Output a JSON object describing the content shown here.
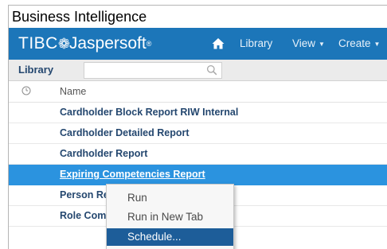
{
  "app": {
    "title": "Business Intelligence"
  },
  "brand": {
    "part1": "TIBC",
    "mark": "❁",
    "part2": "Jaspersoft",
    "reg": "®"
  },
  "nav": {
    "home_icon": "home-icon",
    "items": [
      {
        "label": "Library",
        "has_caret": false
      },
      {
        "label": "View",
        "has_caret": true
      },
      {
        "label": "Create",
        "has_caret": true
      }
    ],
    "caret_glyph": "▼"
  },
  "toolbar": {
    "label": "Library",
    "search": {
      "value": "",
      "placeholder": ""
    },
    "search_icon": "search-icon"
  },
  "list": {
    "header": {
      "clock_icon": "clock-icon",
      "column": "Name"
    },
    "rows": [
      {
        "label": "Cardholder Block Report RIW Internal",
        "selected": false
      },
      {
        "label": "Cardholder Detailed Report",
        "selected": false
      },
      {
        "label": "Cardholder Report",
        "selected": false
      },
      {
        "label": "Expiring Competencies Report",
        "selected": true
      },
      {
        "label": "Person Report",
        "selected": false
      },
      {
        "label": "Role Competencies Percentage",
        "selected": false
      }
    ]
  },
  "context_menu": {
    "items": [
      {
        "label": "Run",
        "highlighted": false
      },
      {
        "label": "Run in New Tab",
        "highlighted": false
      },
      {
        "label": "Schedule...",
        "highlighted": true
      }
    ]
  },
  "colors": {
    "nav_bar": "#1c76b9",
    "selected_row": "#2b93df",
    "menu_highlight": "#1d5d99",
    "link_text": "#24476f"
  }
}
